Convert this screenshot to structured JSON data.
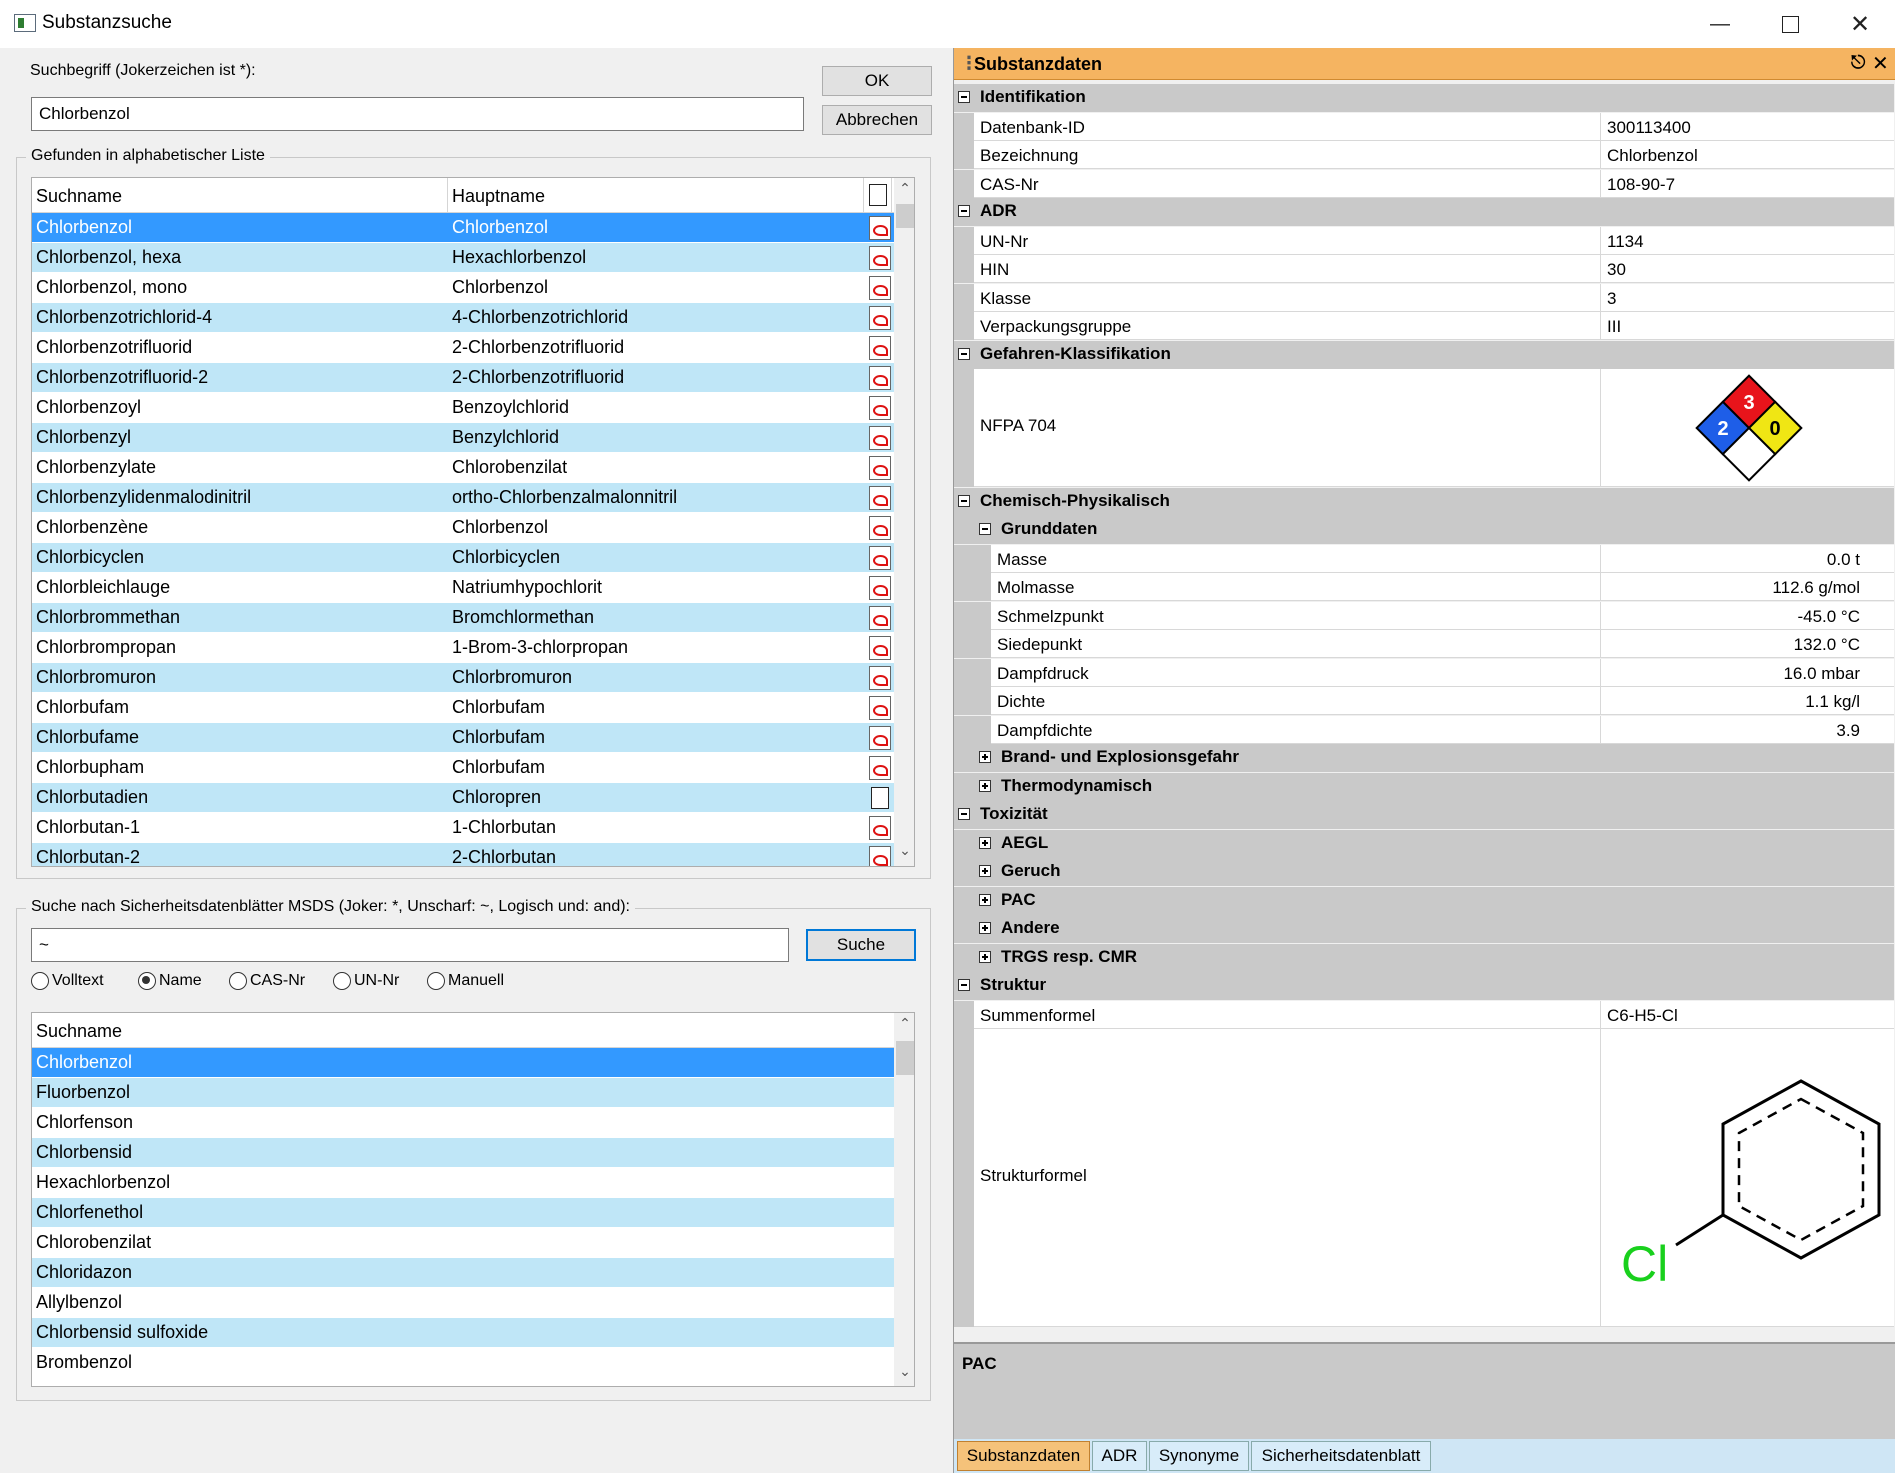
{
  "window": {
    "title": "Substanzsuche"
  },
  "search": {
    "label": "Suchbegriff (Jokerzeichen ist *):",
    "value": "Chlorbenzol",
    "ok": "OK",
    "cancel": "Abbrechen"
  },
  "found": {
    "group_label": "Gefunden in alphabetischer Liste",
    "col_suchname": "Suchname",
    "col_hauptname": "Hauptname",
    "rows": [
      {
        "s": "Chlorbenzol",
        "h": "Chlorbenzol",
        "icon": "pdf-icon"
      },
      {
        "s": "Chlorbenzol, hexa",
        "h": "Hexachlorbenzol",
        "icon": "pdf-icon"
      },
      {
        "s": "Chlorbenzol, mono",
        "h": "Chlorbenzol",
        "icon": "pdf-icon"
      },
      {
        "s": "Chlorbenzotrichlorid-4",
        "h": "4-Chlorbenzotrichlorid",
        "icon": "pdf-icon"
      },
      {
        "s": "Chlorbenzotrifluorid",
        "h": "2-Chlorbenzotrifluorid",
        "icon": "pdf-icon"
      },
      {
        "s": "Chlorbenzotrifluorid-2",
        "h": "2-Chlorbenzotrifluorid",
        "icon": "pdf-icon"
      },
      {
        "s": "Chlorbenzoyl",
        "h": "Benzoylchlorid",
        "icon": "pdf-icon"
      },
      {
        "s": "Chlorbenzyl",
        "h": "Benzylchlorid",
        "icon": "pdf-icon"
      },
      {
        "s": "Chlorbenzylate",
        "h": "Chlorobenzilat",
        "icon": "pdf-icon"
      },
      {
        "s": "Chlorbenzylidenmalodinitril",
        "h": "ortho-Chlorbenzalmalonnitril",
        "icon": "pdf-icon"
      },
      {
        "s": "Chlorbenzène",
        "h": "Chlorbenzol",
        "icon": "pdf-icon"
      },
      {
        "s": "Chlorbicyclen",
        "h": "Chlorbicyclen",
        "icon": "pdf-icon"
      },
      {
        "s": "Chlorbleichlauge",
        "h": "Natriumhypochlorit",
        "icon": "pdf-icon"
      },
      {
        "s": "Chlorbrommethan",
        "h": "Bromchlormethan",
        "icon": "pdf-icon"
      },
      {
        "s": "Chlorbrompropan",
        "h": "1-Brom-3-chlorpropan",
        "icon": "pdf-icon"
      },
      {
        "s": "Chlorbromuron",
        "h": "Chlorbromuron",
        "icon": "pdf-icon"
      },
      {
        "s": "Chlorbufam",
        "h": "Chlorbufam",
        "icon": "pdf-icon"
      },
      {
        "s": "Chlorbufame",
        "h": "Chlorbufam",
        "icon": "pdf-icon"
      },
      {
        "s": "Chlorbupham",
        "h": "Chlorbufam",
        "icon": "pdf-icon"
      },
      {
        "s": "Chlorbutadien",
        "h": "Chloropren",
        "icon": "document-icon"
      },
      {
        "s": "Chlorbutan-1",
        "h": "1-Chlorbutan",
        "icon": "pdf-icon"
      },
      {
        "s": "Chlorbutan-2",
        "h": "2-Chlorbutan",
        "icon": "pdf-icon"
      }
    ]
  },
  "msds": {
    "group_label": "Suche nach Sicherheitsdatenblätter MSDS (Joker: *, Unscharf: ~, Logisch und: and):",
    "value": "~",
    "search_button": "Suche",
    "radios": [
      {
        "label": "Volltext",
        "checked": false
      },
      {
        "label": "Name",
        "checked": true
      },
      {
        "label": "CAS-Nr",
        "checked": false
      },
      {
        "label": "UN-Nr",
        "checked": false
      },
      {
        "label": "Manuell",
        "checked": false
      }
    ],
    "col_suchname": "Suchname",
    "rows": [
      "Chlorbenzol",
      "Fluorbenzol",
      "Chlorfenson",
      "Chlorbensid",
      "Hexachlorbenzol",
      "Chlorfenethol",
      "Chlorobenzilat",
      "Chloridazon",
      "Allylbenzol",
      "Chlorbensid sulfoxide",
      "Brombenzol"
    ]
  },
  "panel": {
    "title": "Substanzdaten",
    "identifikation": {
      "label": "Identifikation",
      "datenbank_id_label": "Datenbank-ID",
      "datenbank_id": "300113400",
      "bezeichnung_label": "Bezeichnung",
      "bezeichnung": "Chlorbenzol",
      "cas_label": "CAS-Nr",
      "cas": "108-90-7"
    },
    "adr": {
      "label": "ADR",
      "un_label": "UN-Nr",
      "un": "1134",
      "hin_label": "HIN",
      "hin": "30",
      "klasse_label": "Klasse",
      "klasse": "3",
      "vg_label": "Verpackungsgruppe",
      "vg": "III"
    },
    "gefahren": {
      "label": "Gefahren-Klassifikation",
      "nfpa_label": "NFPA 704",
      "nfpa_health": "2",
      "nfpa_fire": "3",
      "nfpa_reactivity": "0",
      "nfpa_special": ""
    },
    "chem": {
      "label": "Chemisch-Physikalisch",
      "grunddaten": "Grunddaten",
      "masse_label": "Masse",
      "masse": "0.0 t",
      "molmasse_label": "Molmasse",
      "molmasse": "112.6 g/mol",
      "schmelz_label": "Schmelzpunkt",
      "schmelz": "-45.0 °C",
      "siede_label": "Siedepunkt",
      "siede": "132.0 °C",
      "dampfdruck_label": "Dampfdruck",
      "dampfdruck": "16.0 mbar",
      "dichte_label": "Dichte",
      "dichte": "1.1 kg/l",
      "dampfdichte_label": "Dampfdichte",
      "dampfdichte": "3.9",
      "brand": "Brand- und Explosionsgefahr",
      "thermo": "Thermodynamisch"
    },
    "tox": {
      "label": "Toxizität",
      "aegl": "AEGL",
      "geruch": "Geruch",
      "pac": "PAC",
      "andere": "Andere",
      "trgs": "TRGS resp. CMR"
    },
    "struktur": {
      "label": "Struktur",
      "summen_label": "Summenformel",
      "summen": "C6-H5-Cl",
      "strukt_label": "Strukturformel",
      "cl": "Cl"
    },
    "desc_title": "PAC"
  },
  "tabs": [
    "Substanzdaten",
    "ADR",
    "Synonyme",
    "Sicherheitsdatenblatt"
  ],
  "colors": {
    "selection": "#3399ff",
    "alt_row": "#bfe6f7",
    "panel_header": "#f5b461"
  }
}
